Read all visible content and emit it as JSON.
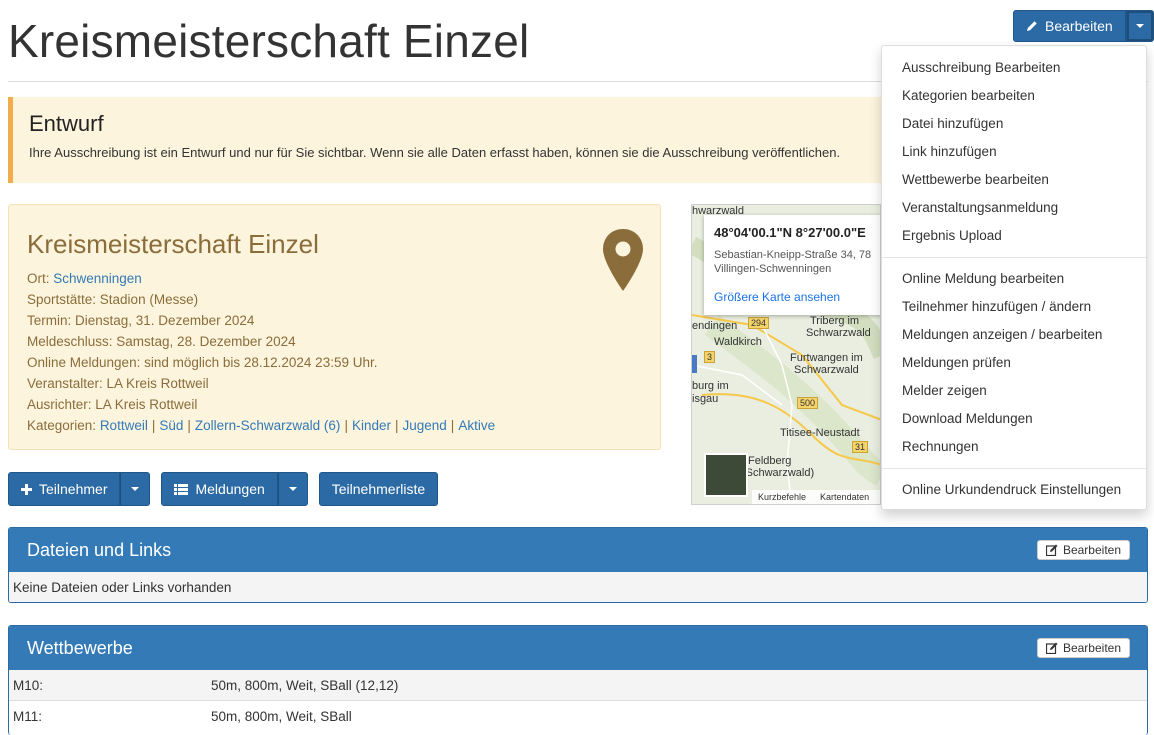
{
  "page": {
    "title": "Kreismeisterschaft Einzel"
  },
  "top_button": {
    "label": "Bearbeiten"
  },
  "alert": {
    "title": "Entwurf",
    "text": "Ihre Ausschreibung ist ein Entwurf und nur für Sie sichtbar. Wenn sie alle Daten erfasst haben, können sie die Ausschreibung veröffentlichen."
  },
  "event": {
    "name": "Kreismeisterschaft Einzel",
    "ort_label": "Ort: ",
    "ort_value": "Schwenningen",
    "sportstaette": "Sportstätte: Stadion (Messe)",
    "termin": "Termin: Dienstag, 31. Dezember 2024",
    "meldeschluss": "Meldeschluss: Samstag, 28. Dezember 2024",
    "online": "Online Meldungen: sind möglich bis 28.12.2024 23:59 Uhr.",
    "veranstalter": "Veranstalter: LA Kreis Rottweil",
    "ausrichter": "Ausrichter: LA Kreis Rottweil",
    "kategorien_label": "Kategorien: ",
    "kategorien": [
      "Rottweil",
      "Süd",
      "Zollern-Schwarzwald (6)",
      "Kinder",
      "Jugend",
      "Aktive"
    ],
    "pin_color": "#8a6d3b"
  },
  "map": {
    "coord": "48°04'00.1\"N 8°27'00.0\"E",
    "addr1": "Sebastian-Kneipp-Straße 34, 78",
    "addr2": "Villingen-Schwenningen",
    "more": "Größere Karte ansehen",
    "labels": {
      "schwarzwald_top": "hwarzwald",
      "triberg": "Triberg im",
      "triberg2": "Schwarzwald",
      "endingen": "endingen",
      "waldkirch": "Waldkirch",
      "furtwangen": "Furtwangen im",
      "furtwangen2": "Schwarzwald",
      "freiburg": "burg im",
      "breisgau": "isgau",
      "titisee": "Titisee-Neustadt",
      "feldberg": "Feldberg",
      "feldberg2": "(Schwarzwald)",
      "r294": "294",
      "r3": "3",
      "r500": "500",
      "r31": "31"
    },
    "foot_short": "Kurzbefehle",
    "foot_data": "Kartendaten"
  },
  "actions": {
    "teilnehmer": "Teilnehmer",
    "meldungen": "Meldungen",
    "teilnehmerliste": "Teilnehmerliste"
  },
  "files_panel": {
    "title": "Dateien und Links",
    "button": "Bearbeiten",
    "empty": "Keine Dateien oder Links vorhanden"
  },
  "wettbewerbe_panel": {
    "title": "Wettbewerbe",
    "button": "Bearbeiten",
    "rows": [
      {
        "key": "M10:",
        "value": "50m, 800m, Weit, SBall (12,12)"
      },
      {
        "key": "M11:",
        "value": "50m, 800m, Weit, SBall"
      }
    ]
  },
  "dropdown": {
    "group1": [
      "Ausschreibung Bearbeiten",
      "Kategorien bearbeiten",
      "Datei hinzufügen",
      "Link hinzufügen",
      "Wettbewerbe bearbeiten",
      "Veranstaltungsanmeldung",
      "Ergebnis Upload"
    ],
    "group2": [
      "Online Meldung bearbeiten",
      "Teilnehmer hinzufügen / ändern",
      "Meldungen anzeigen / bearbeiten",
      "Meldungen prüfen",
      "Melder zeigen",
      "Download Meldungen",
      "Rechnungen"
    ],
    "group3": [
      "Online Urkundendruck Einstellungen"
    ]
  },
  "colors": {
    "primary": "#337ab7",
    "warning_bg": "#fcf4dc",
    "warning_border": "#f0ad4e"
  }
}
